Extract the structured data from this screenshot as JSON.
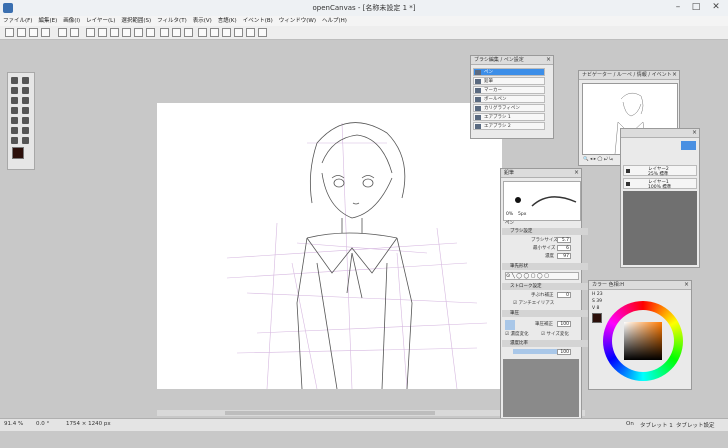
{
  "window": {
    "title": "openCanvas - [名称未設定 1 *]"
  },
  "menubar": [
    "ファイル(F)",
    "編集(E)",
    "画像(I)",
    "レイヤー(L)",
    "選択範囲(S)",
    "フィルタ(T)",
    "表示(V)",
    "言語(K)",
    "イベント(B)",
    "ウィンドウ(W)",
    "ヘルプ(H)"
  ],
  "brush_panel": {
    "title": "ブラシ編集 / ペン設定",
    "items": [
      "ペン",
      "鉛筆",
      "マーカー",
      "ボールペン",
      "カリグラフィペン",
      "エアブラシ 1",
      "エアブラシ 2"
    ]
  },
  "navigator": {
    "title": "ナビゲーター / ルーペ / 情報 / イベント"
  },
  "layer_panel": {
    "layers": [
      {
        "name": "レイヤー2",
        "mode": "25% 標準"
      },
      {
        "name": "レイヤー1",
        "mode": "100% 標準"
      }
    ]
  },
  "brush_settings": {
    "tab": "鉛筆",
    "size_min": "0%",
    "size_max": "5px",
    "name": "ペン",
    "sec_brush": "ブラシ設定",
    "brush_size_label": "ブラシサイズ",
    "brush_size": "5.7",
    "min_size_label": "最小サイズ",
    "min_size": "6",
    "density_label": "濃度",
    "density": "97",
    "sec_shape": "筆先形状",
    "sec_stroke": "ストローク設定",
    "correction_label": "手ぶれ補正",
    "correction": "0",
    "antialias_label": "アンチエイリアス",
    "sec_pressure": "筆圧",
    "pressure_label": "筆圧補正",
    "pressure": "100",
    "density_change": "濃度変化",
    "size_change": "サイズ変化",
    "sec_density": "濃度比率",
    "ratio": "100"
  },
  "color_panel": {
    "tab": "カラー 色相:H",
    "h": "23",
    "s": "39",
    "v": "8"
  },
  "status": {
    "zoom": "91.4 %",
    "angle": "0.0 °",
    "size": "1754 × 1240 px",
    "mode": "On",
    "tablet": "タブレット 1",
    "tablet_mode": "タブレット設定"
  },
  "colors": {
    "fg": "#2b0f0a",
    "bg": "#ffffff"
  }
}
